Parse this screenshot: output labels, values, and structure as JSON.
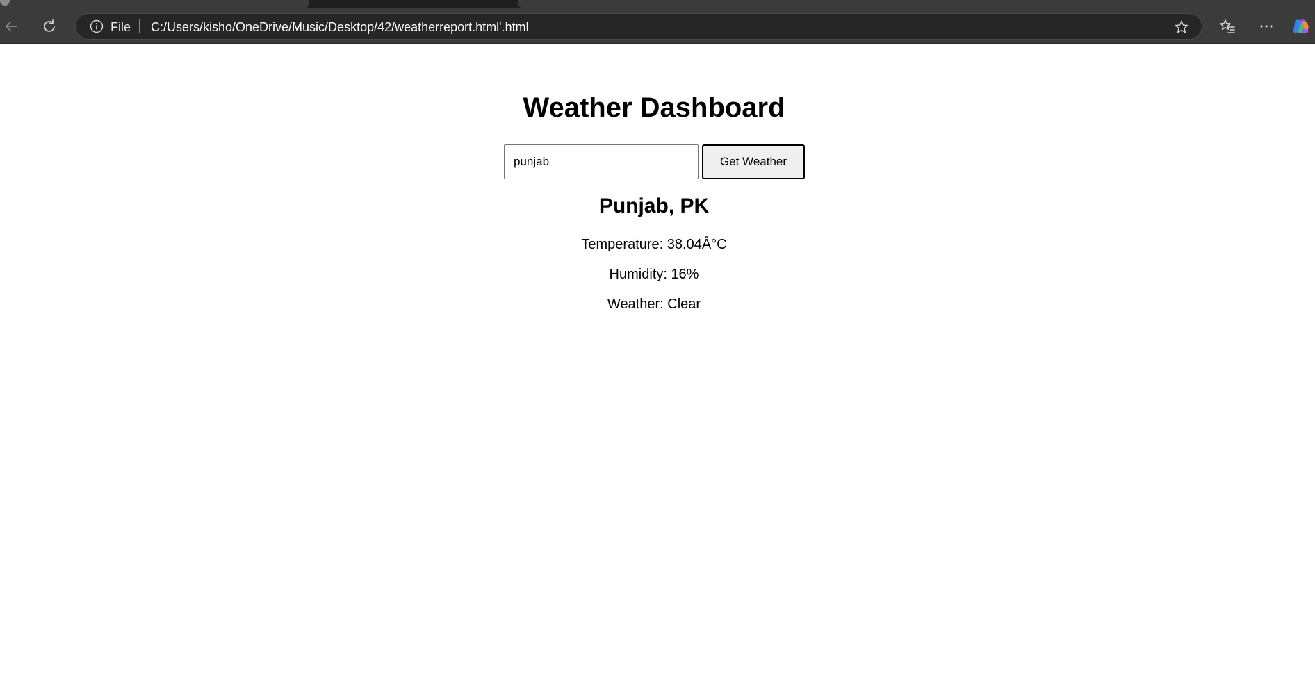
{
  "browser": {
    "address_prefix": "File",
    "url": "C:/Users/kisho/OneDrive/Music/Desktop/42/weatherreport.html'.html",
    "icons": [
      "back-arrow-icon",
      "reload-icon",
      "info-icon",
      "star-icon",
      "favorites-icon",
      "more-icon",
      "copilot-icon"
    ]
  },
  "page": {
    "title": "Weather Dashboard",
    "search": {
      "value": "punjab",
      "button_label": "Get Weather"
    },
    "result": {
      "location": "Punjab, PK",
      "temperature": "Temperature: 38.04Â°C",
      "humidity": "Humidity: 16%",
      "weather": "Weather: Clear"
    }
  },
  "colors": {
    "chrome_bg": "#3b3b3b",
    "address_bg": "#262626",
    "page_bg": "#ffffff",
    "button_bg": "#efefef"
  }
}
